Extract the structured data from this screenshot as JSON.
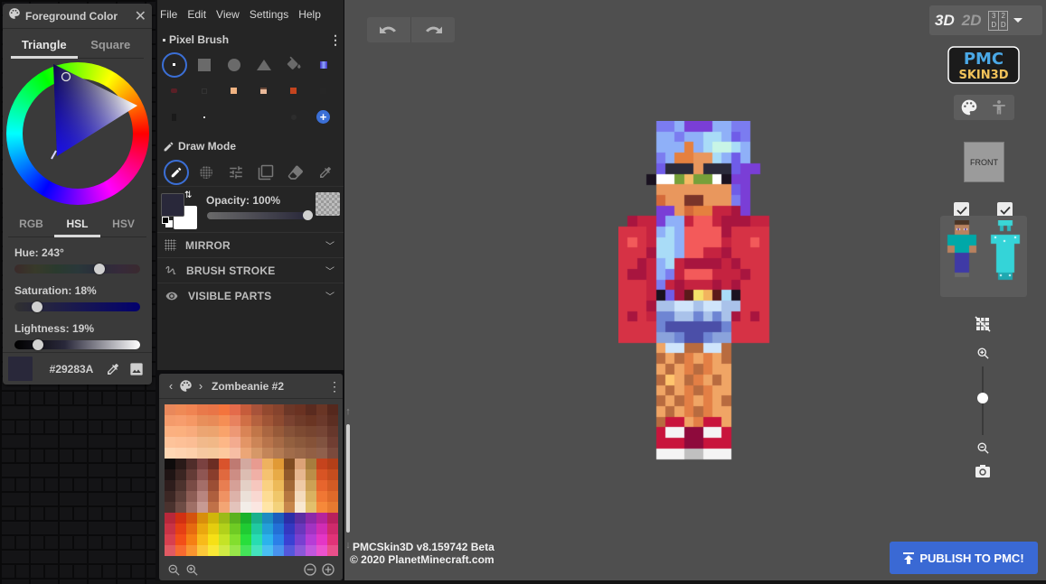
{
  "fg_panel": {
    "title": "Foreground Color",
    "tabs": [
      {
        "label": "Triangle",
        "active": true
      },
      {
        "label": "Square",
        "active": false
      }
    ],
    "modes": [
      {
        "label": "RGB",
        "active": false
      },
      {
        "label": "HSL",
        "active": true
      },
      {
        "label": "HSV",
        "active": false
      }
    ],
    "hue": {
      "label": "Hue: 243°",
      "value": 243,
      "max": 360
    },
    "saturation": {
      "label": "Saturation: 18%",
      "value": 18,
      "max": 100
    },
    "lightness": {
      "label": "Lightness: 19%",
      "value": 19,
      "max": 100
    },
    "hex": "#29283A",
    "color": "#29283a",
    "icons": [
      "palette-icon",
      "close-icon",
      "eyedropper-icon",
      "image-icon"
    ]
  },
  "menubar": [
    "File",
    "Edit",
    "View",
    "Settings",
    "Help"
  ],
  "brush": {
    "title": "Pixel Brush",
    "shapes": [
      "pixel",
      "square",
      "circle",
      "triangle",
      "bucket",
      "stamp-1"
    ],
    "stamps_row2": [
      "#5a1f26",
      "#1d1d1d",
      "#f0b382",
      "#e9b99a",
      "#c4441e",
      "#222"
    ],
    "stamps_row3": [
      "#222",
      "#ddd",
      "",
      "",
      "#2d2d2d",
      "add"
    ]
  },
  "draw_mode": {
    "title": "Draw Mode",
    "tools": [
      "pencil",
      "dither",
      "adjust",
      "layers",
      "eraser",
      "eyedropper"
    ],
    "active": "pencil"
  },
  "opacity": {
    "label": "Opacity: 100%",
    "value": 100,
    "primary": "#29283a",
    "secondary": "#ffffff"
  },
  "accordions": [
    {
      "label": "MIRROR",
      "icon": "mirror-grid-icon"
    },
    {
      "label": "BRUSH STROKE",
      "icon": "brush-stroke-icon"
    },
    {
      "label": "VISIBLE PARTS",
      "icon": "eye-icon"
    }
  ],
  "palette": {
    "name": "Zombeanie #2",
    "rows": [
      [
        "#e9885b",
        "#ef8a56",
        "#f08452",
        "#e9794a",
        "#e97547",
        "#f4743d",
        "#e46b4b",
        "#c65c3b",
        "#a8533a",
        "#93492f",
        "#86432d",
        "#6c3727",
        "#6a3222",
        "#5a2b1f",
        "#693525",
        "#55281d"
      ],
      [
        "#f49b6b",
        "#f79d6d",
        "#f59865",
        "#e88f5b",
        "#e88b58",
        "#f58e55",
        "#e8825f",
        "#d06f46",
        "#b5623f",
        "#a05536",
        "#8d4a30",
        "#7a4230",
        "#6f3b29",
        "#6a3523",
        "#6b392b",
        "#5c2e22"
      ],
      [
        "#fbb080",
        "#fbb07e",
        "#f8ab7c",
        "#eca572",
        "#eca46f",
        "#f9a36b",
        "#ed9875",
        "#d98456",
        "#c17649",
        "#aa6641",
        "#975a39",
        "#865238",
        "#7d4a32",
        "#774530",
        "#764535",
        "#66372b"
      ],
      [
        "#fdc39a",
        "#fdc097",
        "#fbbd94",
        "#f1b98b",
        "#f1b887",
        "#fdb787",
        "#f3ab8f",
        "#e39566",
        "#cc8557",
        "#b8744b",
        "#a66a45",
        "#93603f",
        "#8b593c",
        "#855238",
        "#815340",
        "#703e32"
      ],
      [
        "#fed7b4",
        "#fed3b0",
        "#fdd0ab",
        "#f6c8a0",
        "#f6c99d",
        "#fdc99e",
        "#f7bea4",
        "#eca677",
        "#d69868",
        "#c38559",
        "#b37a52",
        "#a16c4a",
        "#9a6748",
        "#925f44",
        "#8f604c",
        "#7b4a3c"
      ],
      [
        "#0e0b0b",
        "#2a1a18",
        "#502d2a",
        "#7a4140",
        "#6b2d23",
        "#d9532c",
        "#bf7a72",
        "#d3a9a0",
        "#e89b90",
        "#eeb25f",
        "#e19a35",
        "#7f4b21",
        "#dca277",
        "#a77d3e",
        "#c5431d",
        "#b33f18"
      ],
      [
        "#1f1414",
        "#3b2522",
        "#643b36",
        "#8f5653",
        "#893d2c",
        "#e0693f",
        "#cd8d84",
        "#dcbdb2",
        "#f0b0a6",
        "#f5c270",
        "#e8ab47",
        "#90592b",
        "#e7b78f",
        "#bb8e48",
        "#d85424",
        "#c54d1e"
      ],
      [
        "#2e1d1c",
        "#4c322d",
        "#794b45",
        "#a46e69",
        "#9b4e35",
        "#e87e51",
        "#d6a097",
        "#e4d0c6",
        "#f6c7be",
        "#fad182",
        "#edba59",
        "#a26835",
        "#efcaa5",
        "#cca155",
        "#e7652d",
        "#d35b24"
      ],
      [
        "#3c2724",
        "#5d3f39",
        "#8d5d55",
        "#b8857f",
        "#ae5f3e",
        "#ef9263",
        "#ddb2a9",
        "#ebe0d8",
        "#f9d8d1",
        "#fddc94",
        "#f0c76a",
        "#b57740",
        "#f4dbbc",
        "#d9b261",
        "#f07734",
        "#de6a2a"
      ],
      [
        "#4a322e",
        "#6e4c45",
        "#9f6f66",
        "#c79a93",
        "#c07148",
        "#f3a574",
        "#e3c3bb",
        "#f2ede8",
        "#fbe6e1",
        "#ffe5a6",
        "#f3d27b",
        "#c6864b",
        "#f8e8d1",
        "#e2c06c",
        "#f6893a",
        "#e77a30"
      ],
      [
        "#b8283a",
        "#d23012",
        "#d4520e",
        "#d88e0c",
        "#d0b60b",
        "#9cba17",
        "#5bb21f",
        "#1ab22c",
        "#1ab08d",
        "#1e8cc2",
        "#1d5fbd",
        "#2b2ea8",
        "#5b2ea3",
        "#8c2aa8",
        "#b5249c",
        "#b8215d"
      ],
      [
        "#c93345",
        "#e63f14",
        "#e66a10",
        "#eaa70f",
        "#e5cd0f",
        "#b2d11b",
        "#6fcb24",
        "#20cb33",
        "#20c9a1",
        "#249fd9",
        "#2370d6",
        "#3338c1",
        "#6a37bd",
        "#a233c2",
        "#d12cb4",
        "#cf2a6b"
      ],
      [
        "#d7404f",
        "#f34e18",
        "#f57f14",
        "#f8ba1a",
        "#f6e016",
        "#c5e326",
        "#83de2e",
        "#28de3c",
        "#28dcb1",
        "#2cb2ec",
        "#2b80e8",
        "#3a41d3",
        "#7840d0",
        "#b63dd6",
        "#e436c6",
        "#e23378"
      ],
      [
        "#e05a63",
        "#f76a30",
        "#f99530",
        "#fbc83a",
        "#f9e836",
        "#d0ea44",
        "#98e649",
        "#44e459",
        "#44e3bd",
        "#49bff2",
        "#4893ee",
        "#5458db",
        "#8b58d9",
        "#c157de",
        "#eb52cf",
        "#e94f8a"
      ]
    ],
    "icons": [
      "zoom-out-icon",
      "zoom-in-icon",
      "minus-circle-icon",
      "plus-circle-icon"
    ]
  },
  "viewport": {
    "view_modes": [
      "3D",
      "2D",
      "3D|2D"
    ],
    "active_mode": "3D",
    "face_label": "FRONT",
    "layer_checks": [
      true,
      true
    ],
    "zoom_level": 0.5,
    "version_line1": "PMCSkin3D v8.159742 Beta",
    "version_line2": "© 2020 PlanetMinecraft.com",
    "publish_label": "PUBLISH TO PMC!",
    "logo_line1": "PMC",
    "logo_line2": "SKIN3D"
  },
  "skin": {
    "legend": {
      ".": "",
      "a": "#7b7cf0",
      "b": "#8fb0f8",
      "c": "#a9dcf7",
      "d": "#c8f5e6",
      "e": "#6f5ce8",
      "f": "#7a3ed6",
      "g": "#e9975d",
      "h": "#e5803f",
      "i": "#2b2a3a",
      "j": "#ffffff",
      "k": "#77a03a",
      "l": "#f5bb66",
      "m": "#7a3429",
      "n": "#d46a3a",
      "r": "#d63245",
      "s": "#f35a5a",
      "t": "#a8153f",
      "u": "#ff6a5e",
      "v": "#c52340",
      "w": "#1a1220",
      "x": "#5b1a1a",
      "y": "#f5e16a",
      "z": "#f2b45e",
      "p": "#a9c2ea",
      "q": "#cfe5fb",
      "P": "#6e85d3",
      "Q": "#4b4fa8",
      "R": "#8aa3dc",
      "o": "#f0a565",
      "O": "#b86b3f",
      "N": "#e37f45",
      "K": "#ffc56e",
      "S": "#c8143c",
      "T": "#8e0a3c",
      "W": "#f4f4f4",
      "G": "#c0c0c0"
    },
    "rows": [
      "....aabfffbbaa..",
      "....bbabbccbea..",
      "....bbbhbcddcb..",
      "....abhhggcbeb..",
      "....eiiigiiieff.",
      "...wjjklkkjwff..",
      "....ggggggggef..",
      "....nggmmgggaf..",
      "....ffgnhhvvtf..",
      ".tvvfbbvssvtttvv",
      "rrrvbcbsssstrrrr",
      "rsrvccbssssvrrsr",
      "rrrtccbssvvtrrrr",
      "rrtvbcvttttvtrrr",
      "rttvbavsssvvvtrr",
      "rrrvavtvvvtvtrrr",
      "rrrvwetxyzxcwrrr",
      "rrrtppqqpqqpprrr",
      "rtrvPPppPpPptrtr",
      "rrrrPQQQQQQPrrrr",
      "rrrrRRPQQPRRrrrr",
      "....oqqOOqqO....",
      "....OoONoNoO....",
      "....oOoNONoo....",
      "....OKoONoOo....",
      "....oOoNONoo....",
      "....OoONoNoO....",
      "....oOoNONoo....",
      "....OSSoNSSo....",
      "....SWWTTWWS....",
      "....SSSTTSSS....",
      "....WWWGGWWW...."
    ]
  }
}
